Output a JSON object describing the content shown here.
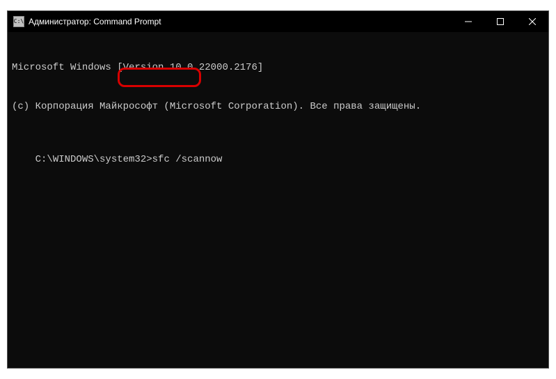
{
  "window": {
    "title": "Администратор: Command Prompt",
    "icon_label": "cmd"
  },
  "terminal": {
    "line1": "Microsoft Windows [Version 10.0.22000.2176]",
    "line2": "(c) Корпорация Майкрософт (Microsoft Corporation). Все права защищены.",
    "blank": "",
    "prompt": "C:\\WINDOWS\\system32>",
    "command": "sfc /scannow"
  },
  "controls": {
    "minimize": "minimize",
    "maximize": "maximize",
    "close": "close"
  },
  "annotation": {
    "highlight_target": "command-input"
  }
}
